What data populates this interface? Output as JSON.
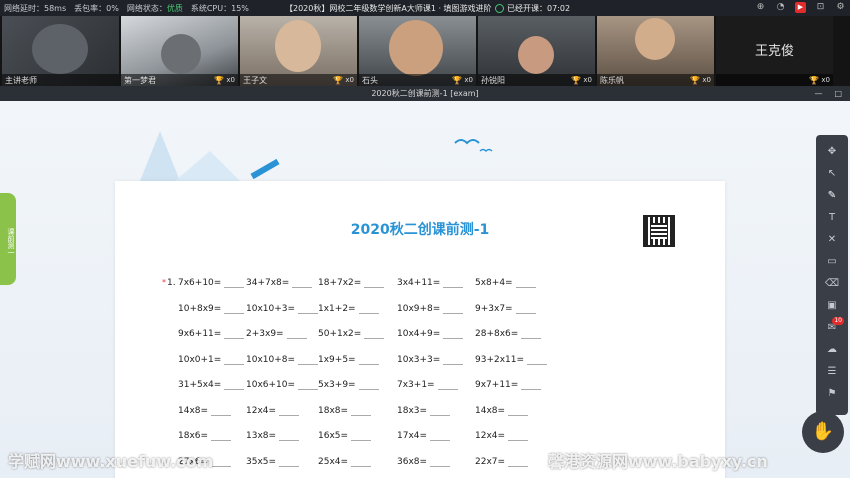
{
  "topbar": {
    "stats": [
      {
        "label": "网络延时：58ms"
      },
      {
        "label": "丢包率：0%"
      },
      {
        "label": "网络状态：",
        "status": "优质"
      },
      {
        "label": "系统CPU：15%"
      }
    ],
    "title": "【2020秋】网校二年级数学创新A大师课1 · 填图游戏进阶",
    "timer": "已经开课：07:02"
  },
  "videos": [
    {
      "name": "主讲老师",
      "trophy": "",
      "count": ""
    },
    {
      "name": "第一梦君",
      "trophy": "🏆",
      "count": "x0"
    },
    {
      "name": "王子文",
      "trophy": "🏆",
      "count": "x0"
    },
    {
      "name": "石头",
      "trophy": "🏆",
      "count": "x0"
    },
    {
      "name": "孙锐阳",
      "trophy": "🏆",
      "count": "x0"
    },
    {
      "name": "陈乐帆",
      "trophy": "🏆",
      "count": "x0"
    },
    {
      "name": "王克俊",
      "trophy": "🏆",
      "count": "x0",
      "big": "王克俊"
    }
  ],
  "window_title": "2020秋二创课前测-1 [exam]",
  "sidetab": "课前测一",
  "paper": {
    "title": "2020秋二创课前测-1",
    "question_number": "1.",
    "rows": [
      [
        "7x6+10=",
        "34+7x8=",
        "18+7x2=",
        "3x4+11=",
        "5x8+4="
      ],
      [
        "10+8x9=",
        "10x10+3=",
        "1x1+2=",
        "10x9+8=",
        "9+3x7="
      ],
      [
        "9x6+11=",
        "2+3x9=",
        "50+1x2=",
        "10x4+9=",
        "28+8x6="
      ],
      [
        "10x0+1=",
        "10x10+8=",
        "1x9+5=",
        "10x3+3=",
        "93+2x11="
      ],
      [
        "31+5x4=",
        "10x6+10=",
        "5x3+9=",
        "7x3+1=",
        "9x7+11="
      ],
      [
        "14x8=",
        "12x4=",
        "18x8=",
        "18x3=",
        "14x8="
      ],
      [
        "18x6=",
        "13x8=",
        "16x5=",
        "17x4=",
        "12x4="
      ],
      [
        "27x6=",
        "35x5=",
        "25x4=",
        "36x8=",
        "22x7="
      ]
    ]
  },
  "toolbar": {
    "badge": "10"
  },
  "watermarks": [
    "学赋网www.xuefuw.com",
    "馨港资源网www.babyxy.cn"
  ]
}
